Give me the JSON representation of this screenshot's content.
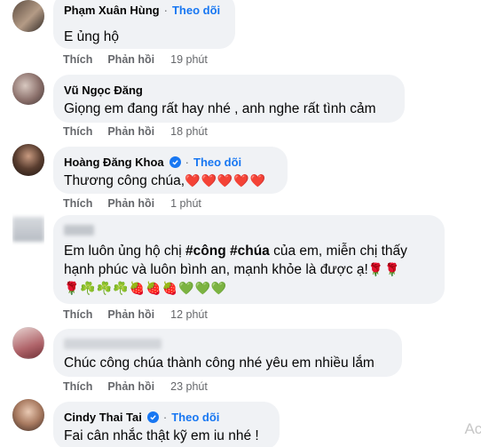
{
  "comments": [
    {
      "author": "Phạm Xuân Hùng",
      "follow": "Theo dõi",
      "text": "E ủng hộ",
      "like": "Thích",
      "reply": "Phản hồi",
      "time": "19 phút"
    },
    {
      "author": "Vũ Ngọc Đăng",
      "text": "Giọng em đang rất hay nhé , anh nghe rất tình cảm",
      "like": "Thích",
      "reply": "Phản hồi",
      "time": "18 phút"
    },
    {
      "author": "Hoàng Đăng Khoa",
      "follow": "Theo dõi",
      "text": "Thương công chúa,",
      "emojis": "❤️❤️❤️❤️❤️",
      "like": "Thích",
      "reply": "Phản hồi",
      "time": "1 phút"
    },
    {
      "author": "",
      "text_pre": "Em luôn ủng hộ chị ",
      "tag1": "#công",
      "tag2": "#chúa",
      "text_post": " của em, miễn chị thấy",
      "text_line2": "hạnh phúc và luôn bình an, mạnh khỏe là được ạ!",
      "emojis_line2": "🌹🌹",
      "emojis_line3": "🌹☘️☘️☘️🍓🍓🍓💚💚💚",
      "like": "Thích",
      "reply": "Phản hồi",
      "time": "12 phút"
    },
    {
      "author": "",
      "text": "Chúc công chúa thành công nhé yêu em nhiều lắm",
      "like": "Thích",
      "reply": "Phản hồi",
      "time": "23 phút"
    },
    {
      "author": "Cindy Thai Tai",
      "follow": "Theo dõi",
      "text": "Fai cân nhắc thật kỹ em iu nhé !"
    }
  ],
  "watermark": "Act"
}
